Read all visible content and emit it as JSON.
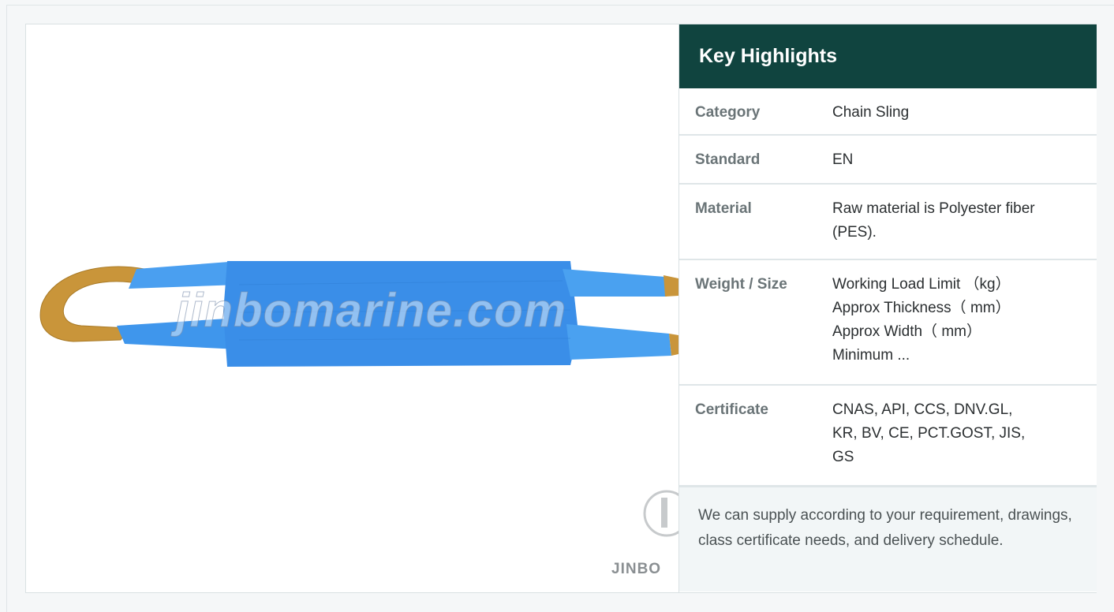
{
  "product_image": {
    "watermark_text": "jinbomarine.com",
    "logo_text": "JINBO"
  },
  "highlights": {
    "title": "Key Highlights",
    "rows": [
      {
        "label": "Category",
        "value_lines": [
          "Chain Sling"
        ]
      },
      {
        "label": "Standard",
        "value_lines": [
          "EN"
        ]
      },
      {
        "label": "Material",
        "value_lines": [
          "Raw material is Polyester fiber",
          "(PES)."
        ]
      },
      {
        "label": "Weight / Size",
        "value_lines": [
          "Working Load Limit （kg）",
          "Approx Thickness（ mm）",
          "Approx Width（ mm）",
          "Minimum ..."
        ]
      },
      {
        "label": "Certificate",
        "value_lines": [
          "CNAS, API, CCS, DNV.GL,",
          "KR, BV, CE, PCT.GOST, JIS,",
          "GS"
        ]
      }
    ],
    "note": "We can supply according to your requirement, drawings, class certificate needs, and delivery schedule."
  },
  "colors": {
    "header_bg": "#10443f",
    "sling_blue": "#3a8ee8",
    "sling_eye": "#c9953a"
  }
}
